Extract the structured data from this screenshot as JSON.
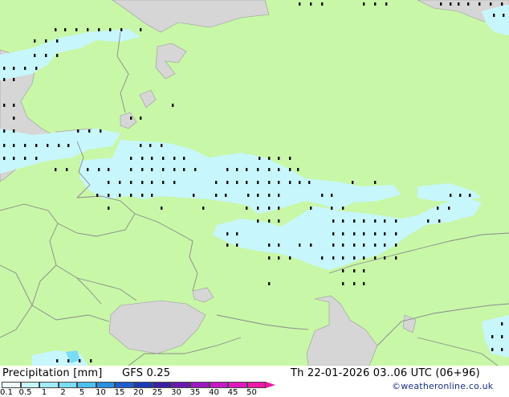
{
  "map": {
    "colors": {
      "land": "#c8f7a8",
      "sea": "#d6d6d6",
      "precip_light": "#c8f6fd",
      "precip_mid": "#9de6f6",
      "precip_dark": "#6ec6f0",
      "border": "#8a8a8a",
      "dot": "#111111"
    }
  },
  "footer": {
    "title": "Precipitation [mm]",
    "model": "GFS 0.25",
    "validity": "Th 22-01-2026 03..06 UTC (06+96)",
    "credit": "©weatheronline.co.uk"
  },
  "legend": {
    "ticks": [
      "0.1",
      "0.5",
      "1",
      "2",
      "5",
      "10",
      "15",
      "20",
      "25",
      "30",
      "35",
      "40",
      "45",
      "50"
    ],
    "colors": [
      "#f0fcff",
      "#c8f6fd",
      "#a0ecfb",
      "#78dcf5",
      "#4cc0ee",
      "#2a90e0",
      "#1e5ed0",
      "#1a3ab8",
      "#3a20a8",
      "#6a18b0",
      "#9a18c0",
      "#c818c8",
      "#e018c0",
      "#f018a8"
    ]
  }
}
